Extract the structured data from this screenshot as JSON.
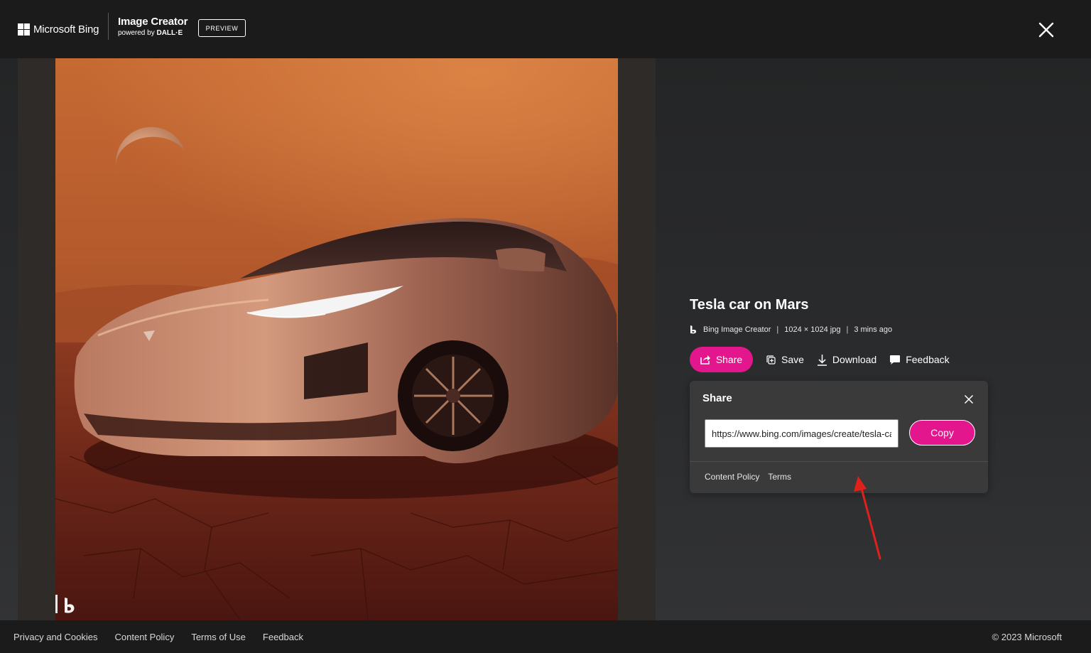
{
  "header": {
    "brand_name": "Microsoft Bing",
    "product_title": "Image Creator",
    "product_sub_prefix": "powered by",
    "product_sub_engine": "DALL·E",
    "badge": "PREVIEW"
  },
  "image": {
    "alt": "Tesla car on Mars"
  },
  "details": {
    "title": "Tesla car on Mars",
    "meta": {
      "source": "Bing Image Creator",
      "dimensions": "1024 × 1024 jpg",
      "time": "3 mins ago",
      "separator": "|"
    },
    "actions": {
      "share": "Share",
      "save": "Save",
      "download": "Download",
      "feedback": "Feedback"
    }
  },
  "share_popup": {
    "title": "Share",
    "url": "https://www.bing.com/images/create/tesla-car-on-mars",
    "copy_label": "Copy",
    "links": [
      "Content Policy",
      "Terms"
    ]
  },
  "footer": {
    "links": [
      "Privacy and Cookies",
      "Content Policy",
      "Terms of Use",
      "Feedback"
    ],
    "copyright": "© 2023 Microsoft"
  },
  "colors": {
    "accent": "#e3168e",
    "background": "#1b1b1b",
    "popup": "#3a3a3a",
    "annotation_arrow": "#e0201b"
  }
}
